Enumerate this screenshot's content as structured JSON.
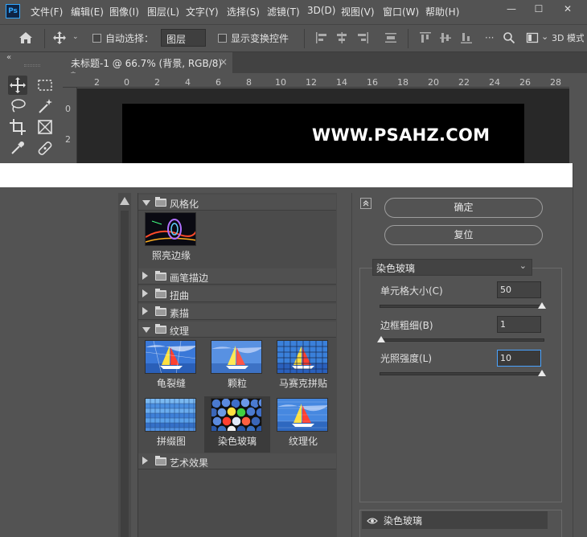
{
  "app": {
    "logo": "Ps"
  },
  "menu": [
    "文件(F)",
    "编辑(E)",
    "图像(I)",
    "图层(L)",
    "文字(Y)",
    "选择(S)",
    "滤镜(T)",
    "3D(D)",
    "视图(V)",
    "窗口(W)",
    "帮助(H)"
  ],
  "window_controls": {
    "minimize": "—",
    "maximize": "☐",
    "close": "✕"
  },
  "options": {
    "auto_select_label": "自动选择：",
    "auto_select_checked": false,
    "auto_select_target": "图层",
    "show_transform_label": "显示变换控件",
    "show_transform_checked": false,
    "mode_3d_label": "3D 模式"
  },
  "document": {
    "tab_title": "未标题-1 @ 66.7% (背景, RGB/8) *",
    "ruler_top": [
      "2",
      "0",
      "2",
      "4",
      "6",
      "8",
      "10",
      "12",
      "14",
      "16",
      "18",
      "20",
      "22",
      "24",
      "26",
      "28"
    ],
    "ruler_left": [
      "0",
      "2"
    ],
    "canvas_text": "WWW.PSAHZ.COM"
  },
  "gallery": {
    "categories": [
      {
        "label": "风格化",
        "expanded": true,
        "filters": [
          "照亮边缘"
        ]
      },
      {
        "label": "画笔描边",
        "expanded": false
      },
      {
        "label": "扭曲",
        "expanded": false
      },
      {
        "label": "素描",
        "expanded": false
      },
      {
        "label": "纹理",
        "expanded": true,
        "filters": [
          "龟裂缝",
          "颗粒",
          "马赛克拼贴",
          "拼缀图",
          "染色玻璃",
          "纹理化"
        ]
      },
      {
        "label": "艺术效果",
        "expanded": false
      }
    ],
    "selected_filter": "染色玻璃"
  },
  "settings": {
    "ok_label": "确定",
    "reset_label": "复位",
    "filter_select": "染色玻璃",
    "params": [
      {
        "label": "单元格大小(C)",
        "value": "50",
        "level": 1.0
      },
      {
        "label": "边框粗细(B)",
        "value": "1",
        "level": 0.0
      },
      {
        "label": "光照强度(L)",
        "value": "10",
        "level": 1.0
      }
    ],
    "layer_effect_name": "染色玻璃"
  }
}
